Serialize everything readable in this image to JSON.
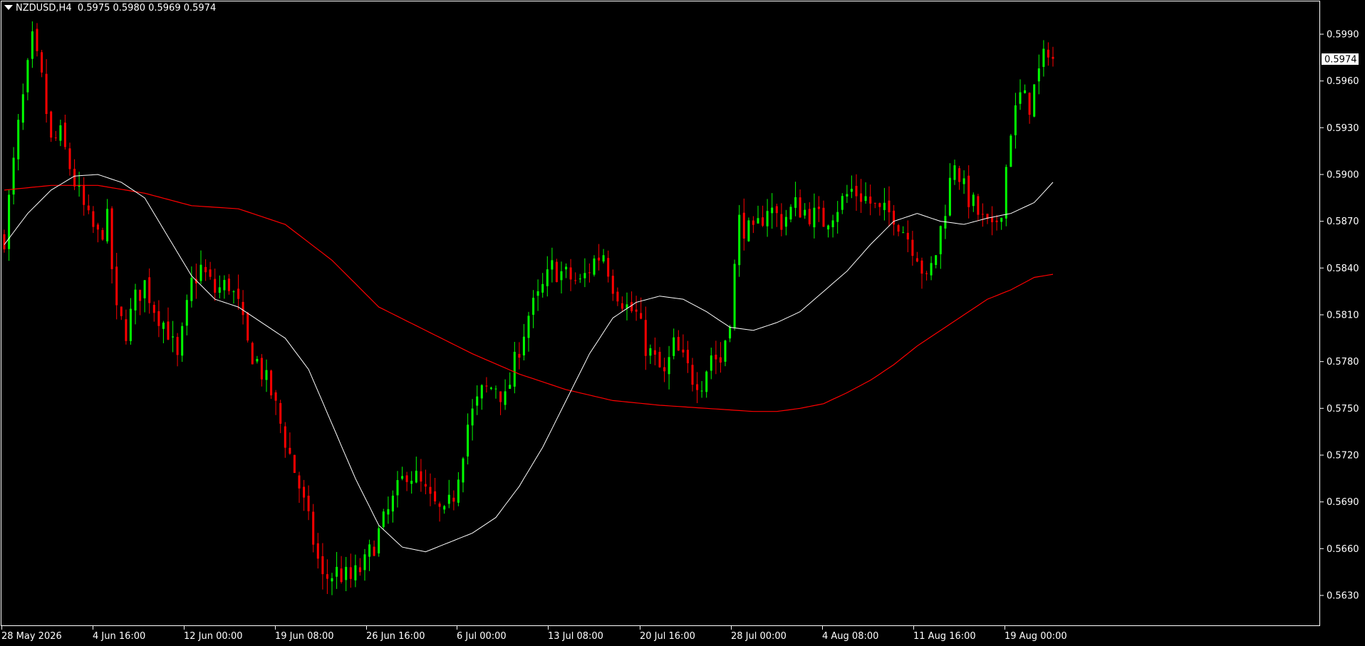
{
  "header": {
    "symbol": "NZDUSD,H4",
    "ohlc": "0.5975 0.5980 0.5969 0.5974"
  },
  "colors": {
    "background": "#000000",
    "bull": "#00ff00",
    "bear": "#ff0000",
    "ma_fast": "#ffffff",
    "ma_slow": "#ff0000",
    "axis": "#ffffff",
    "price_label_bg": "#ffffff"
  },
  "chart_data": {
    "type": "candlestick",
    "symbol": "NZDUSD",
    "timeframe": "H4",
    "current_price": "0.5974",
    "y_ticks": [
      "0.5990",
      "0.5960",
      "0.5930",
      "0.5900",
      "0.5870",
      "0.5840",
      "0.5810",
      "0.5780",
      "0.5750",
      "0.5720",
      "0.5690",
      "0.5660",
      "0.5630"
    ],
    "ylim": [
      0.5618,
      0.6008
    ],
    "x_ticks": [
      "28 May 2026",
      "4 Jun 16:00",
      "12 Jun 00:00",
      "19 Jun 08:00",
      "26 Jun 16:00",
      "6 Jul 00:00",
      "13 Jul 08:00",
      "20 Jul 16:00",
      "28 Jul 00:00",
      "4 Aug 08:00",
      "11 Aug 16:00",
      "19 Aug 00:00"
    ],
    "close_path": [
      [
        0,
        0.586
      ],
      [
        3,
        0.593
      ],
      [
        6,
        0.5985
      ],
      [
        8,
        0.596
      ],
      [
        10,
        0.592
      ],
      [
        12,
        0.5925
      ],
      [
        15,
        0.5895
      ],
      [
        18,
        0.587
      ],
      [
        20,
        0.586
      ],
      [
        22,
        0.587
      ],
      [
        24,
        0.581
      ],
      [
        26,
        0.58
      ],
      [
        28,
        0.582
      ],
      [
        30,
        0.583
      ],
      [
        32,
        0.5815
      ],
      [
        35,
        0.58
      ],
      [
        37,
        0.578
      ],
      [
        40,
        0.583
      ],
      [
        42,
        0.584
      ],
      [
        45,
        0.5825
      ],
      [
        48,
        0.583
      ],
      [
        50,
        0.5815
      ],
      [
        52,
        0.579
      ],
      [
        54,
        0.578
      ],
      [
        57,
        0.576
      ],
      [
        60,
        0.573
      ],
      [
        63,
        0.57
      ],
      [
        66,
        0.5665
      ],
      [
        68,
        0.564
      ],
      [
        71,
        0.5645
      ],
      [
        74,
        0.564
      ],
      [
        77,
        0.565
      ],
      [
        80,
        0.567
      ],
      [
        83,
        0.569
      ],
      [
        86,
        0.571
      ],
      [
        88,
        0.5705
      ],
      [
        91,
        0.569
      ],
      [
        94,
        0.568
      ],
      [
        96,
        0.5695
      ],
      [
        99,
        0.574
      ],
      [
        102,
        0.576
      ],
      [
        105,
        0.5765
      ],
      [
        107,
        0.5755
      ],
      [
        110,
        0.579
      ],
      [
        112,
        0.581
      ],
      [
        114,
        0.582
      ],
      [
        117,
        0.584
      ],
      [
        120,
        0.5835
      ],
      [
        123,
        0.583
      ],
      [
        126,
        0.5845
      ],
      [
        128,
        0.585
      ],
      [
        130,
        0.583
      ],
      [
        133,
        0.5815
      ],
      [
        135,
        0.581
      ],
      [
        137,
        0.579
      ],
      [
        139,
        0.578
      ],
      [
        141,
        0.577
      ],
      [
        143,
        0.579
      ],
      [
        145,
        0.578
      ],
      [
        147,
        0.577
      ],
      [
        149,
        0.5768
      ],
      [
        151,
        0.5785
      ],
      [
        153,
        0.578
      ],
      [
        155,
        0.581
      ],
      [
        157,
        0.587
      ],
      [
        160,
        0.586
      ],
      [
        163,
        0.588
      ],
      [
        166,
        0.587
      ],
      [
        169,
        0.588
      ],
      [
        172,
        0.5875
      ],
      [
        175,
        0.587
      ],
      [
        178,
        0.588
      ],
      [
        181,
        0.589
      ],
      [
        184,
        0.5885
      ],
      [
        187,
        0.5875
      ],
      [
        190,
        0.5875
      ],
      [
        193,
        0.586
      ],
      [
        195,
        0.585
      ],
      [
        197,
        0.583
      ],
      [
        199,
        0.585
      ],
      [
        201,
        0.588
      ],
      [
        203,
        0.591
      ],
      [
        205,
        0.589
      ],
      [
        207,
        0.588
      ],
      [
        209,
        0.587
      ],
      [
        211,
        0.5862
      ],
      [
        213,
        0.588
      ],
      [
        215,
        0.593
      ],
      [
        217,
        0.595
      ],
      [
        219,
        0.5945
      ],
      [
        221,
        0.5965
      ],
      [
        223,
        0.5982
      ],
      [
        224,
        0.5974
      ]
    ],
    "ma_fast_path": [
      [
        0,
        0.5855
      ],
      [
        5,
        0.5875
      ],
      [
        10,
        0.589
      ],
      [
        15,
        0.5899
      ],
      [
        20,
        0.59
      ],
      [
        25,
        0.5895
      ],
      [
        30,
        0.5885
      ],
      [
        35,
        0.586
      ],
      [
        40,
        0.5835
      ],
      [
        45,
        0.582
      ],
      [
        50,
        0.5815
      ],
      [
        55,
        0.5805
      ],
      [
        60,
        0.5795
      ],
      [
        65,
        0.5775
      ],
      [
        70,
        0.574
      ],
      [
        75,
        0.5705
      ],
      [
        80,
        0.5675
      ],
      [
        85,
        0.5661
      ],
      [
        90,
        0.5658
      ],
      [
        95,
        0.5664
      ],
      [
        100,
        0.567
      ],
      [
        105,
        0.568
      ],
      [
        110,
        0.57
      ],
      [
        115,
        0.5725
      ],
      [
        120,
        0.5755
      ],
      [
        125,
        0.5785
      ],
      [
        130,
        0.5808
      ],
      [
        135,
        0.5818
      ],
      [
        140,
        0.5822
      ],
      [
        145,
        0.582
      ],
      [
        150,
        0.5812
      ],
      [
        155,
        0.5802
      ],
      [
        160,
        0.58
      ],
      [
        165,
        0.5805
      ],
      [
        170,
        0.5812
      ],
      [
        175,
        0.5825
      ],
      [
        180,
        0.5838
      ],
      [
        185,
        0.5855
      ],
      [
        190,
        0.587
      ],
      [
        195,
        0.5875
      ],
      [
        200,
        0.587
      ],
      [
        205,
        0.5868
      ],
      [
        210,
        0.5872
      ],
      [
        215,
        0.5875
      ],
      [
        220,
        0.5882
      ],
      [
        224,
        0.5895
      ]
    ],
    "ma_slow_path": [
      [
        0,
        0.589
      ],
      [
        10,
        0.5893
      ],
      [
        20,
        0.5893
      ],
      [
        30,
        0.5888
      ],
      [
        40,
        0.588
      ],
      [
        50,
        0.5878
      ],
      [
        60,
        0.5868
      ],
      [
        70,
        0.5845
      ],
      [
        80,
        0.5815
      ],
      [
        90,
        0.58
      ],
      [
        100,
        0.5785
      ],
      [
        110,
        0.5772
      ],
      [
        120,
        0.5762
      ],
      [
        130,
        0.5755
      ],
      [
        140,
        0.5752
      ],
      [
        150,
        0.575
      ],
      [
        160,
        0.5748
      ],
      [
        165,
        0.5748
      ],
      [
        170,
        0.575
      ],
      [
        175,
        0.5753
      ],
      [
        180,
        0.576
      ],
      [
        185,
        0.5768
      ],
      [
        190,
        0.5778
      ],
      [
        195,
        0.579
      ],
      [
        200,
        0.58
      ],
      [
        205,
        0.581
      ],
      [
        210,
        0.582
      ],
      [
        215,
        0.5826
      ],
      [
        220,
        0.5834
      ],
      [
        224,
        0.5836
      ]
    ],
    "grid": false,
    "legend": "none"
  }
}
